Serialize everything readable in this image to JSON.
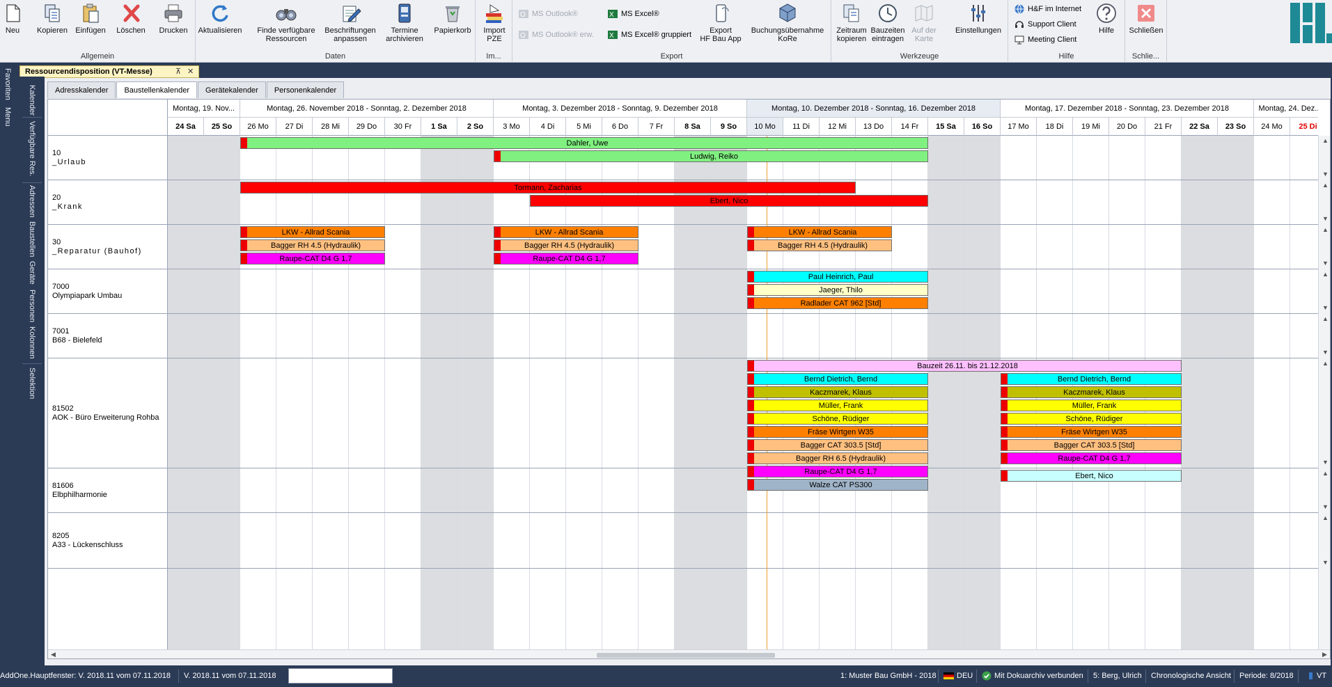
{
  "ribbon": {
    "groups": {
      "allgemein": "Allgemein",
      "daten": "Daten",
      "import": "Im...",
      "export": "Export",
      "werkzeuge": "Werkzeuge",
      "hilfe": "Hilfe",
      "schliessen": "Schlie..."
    },
    "buttons": {
      "neu": "Neu",
      "kopieren": "Kopieren",
      "einfuegen": "Einfügen",
      "loeschen": "Löschen",
      "drucken": "Drucken",
      "aktualisieren": "Aktualisieren",
      "finde_l1": "Finde verfügbare",
      "finde_l2": "Ressourcen",
      "beschr_l1": "Beschriftungen",
      "beschr_l2": "anpassen",
      "termine_l1": "Termine",
      "termine_l2": "archivieren",
      "papierkorb": "Papierkorb",
      "import_l1": "Import",
      "import_l2": "PZE",
      "ms_outlook": "MS Outlook®",
      "ms_outlook_erw": "MS Outlook® erw.",
      "ms_excel": "MS Excel®",
      "ms_excel_grp": "MS Excel® gruppiert",
      "export_l1": "Export",
      "export_l2": "HF Bau App",
      "buchung_l1": "Buchungsübernahme",
      "buchung_l2": "KoRe",
      "zeitraum_l1": "Zeitraum",
      "zeitraum_l2": "kopieren",
      "bauzeiten_l1": "Bauzeiten",
      "bauzeiten_l2": "eintragen",
      "karte_l1": "Auf der",
      "karte_l2": "Karte",
      "einstellungen": "Einstellungen",
      "hf_internet": "H&F im Internet",
      "support": "Support Client",
      "meeting": "Meeting Client",
      "hilfe": "Hilfe",
      "schliessen": "Schließen"
    }
  },
  "left_outer_tabs": [
    "Favoriten",
    "Menu"
  ],
  "left_inner_tabs": [
    "Kalender",
    "Verfügbare Res.",
    "Adressen",
    "Baustellen",
    "Geräte",
    "Personen",
    "Kolonnen",
    "Selektion"
  ],
  "doc_tab": {
    "title": "Ressourcendisposition (VT-Messe)",
    "pin": "⊼",
    "close": "✕"
  },
  "subtabs": [
    "Adresskalender",
    "Baustellenkalender",
    "Gerätekalender",
    "Personenkalender"
  ],
  "calendar": {
    "weeks": [
      "Montag, 19. Nov...",
      "Montag, 26. November 2018 - Sonntag, 2. Dezember 2018",
      "Montag, 3. Dezember 2018 - Sonntag, 9. Dezember 2018",
      "Montag, 10. Dezember 2018 - Sonntag, 16. Dezember 2018",
      "Montag, 17. Dezember 2018 - Sonntag, 23. Dezember 2018",
      "Montag, 24. Dez..."
    ],
    "days": [
      "24 Sa",
      "25 So",
      "26 Mo",
      "27 Di",
      "28 Mi",
      "29 Do",
      "30 Fr",
      "1 Sa",
      "2 So",
      "3 Mo",
      "4 Di",
      "5 Mi",
      "6 Do",
      "7 Fr",
      "8 Sa",
      "9 So",
      "10 Mo",
      "11 Di",
      "12 Mi",
      "13 Do",
      "14 Fr",
      "15 Sa",
      "16 So",
      "17 Mo",
      "18 Di",
      "19 Mi",
      "20 Do",
      "21 Fr",
      "22 Sa",
      "23 So",
      "24 Mo",
      "25 Di"
    ],
    "rows": [
      {
        "code": "10",
        "name": "_Urlaub"
      },
      {
        "code": "20",
        "name": "_Krank"
      },
      {
        "code": "30",
        "name": "_Reparatur (Bauhof)"
      },
      {
        "code": "7000",
        "name": "Olympiapark Umbau"
      },
      {
        "code": "7001",
        "name": "B68 - Bielefeld"
      },
      {
        "code": "81502",
        "name": "AOK - Büro Erweiterung Rohba"
      },
      {
        "code": "81606",
        "name": "Elbphilharmonie"
      },
      {
        "code": "8205",
        "name": "A33 - Lückenschluss"
      }
    ],
    "bars": [
      {
        "row": 0,
        "lane": 0,
        "start": 2,
        "end": 21,
        "label": "Dahler, Uwe",
        "color": "#80f080",
        "marker": true
      },
      {
        "row": 0,
        "lane": 1,
        "start": 9,
        "end": 21,
        "label": "Ludwig, Reiko",
        "color": "#80f080",
        "marker": true
      },
      {
        "row": 1,
        "lane": 0,
        "start": 2,
        "end": 19,
        "label": "Tormann, Zacharias",
        "color": "#ff0000",
        "marker": false
      },
      {
        "row": 1,
        "lane": 1,
        "start": 10,
        "end": 21,
        "label": "Ebert, Nico",
        "color": "#ff0000",
        "marker": false
      },
      {
        "row": 2,
        "lane": 0,
        "start": 2,
        "end": 6,
        "label": "LKW - Allrad Scania",
        "color": "#ff8000",
        "marker": true
      },
      {
        "row": 2,
        "lane": 1,
        "start": 2,
        "end": 6,
        "label": "Bagger RH 4.5 (Hydraulik)",
        "color": "#ffc080",
        "marker": true
      },
      {
        "row": 2,
        "lane": 2,
        "start": 2,
        "end": 6,
        "label": "Raupe-CAT D4 G 1,7",
        "color": "#ff00ff",
        "marker": true
      },
      {
        "row": 2,
        "lane": 0,
        "start": 9,
        "end": 13,
        "label": "LKW - Allrad Scania",
        "color": "#ff8000",
        "marker": true
      },
      {
        "row": 2,
        "lane": 1,
        "start": 9,
        "end": 13,
        "label": "Bagger RH 4.5 (Hydraulik)",
        "color": "#ffc080",
        "marker": true
      },
      {
        "row": 2,
        "lane": 2,
        "start": 9,
        "end": 13,
        "label": "Raupe-CAT D4 G 1,7",
        "color": "#ff00ff",
        "marker": true
      },
      {
        "row": 2,
        "lane": 0,
        "start": 16,
        "end": 20,
        "label": "LKW - Allrad Scania",
        "color": "#ff8000",
        "marker": true
      },
      {
        "row": 2,
        "lane": 1,
        "start": 16,
        "end": 20,
        "label": "Bagger RH 4.5 (Hydraulik)",
        "color": "#ffc080",
        "marker": true
      },
      {
        "row": 3,
        "lane": 0,
        "start": 16,
        "end": 21,
        "label": "Paul Heinrich, Paul",
        "color": "#00ffff",
        "marker": true
      },
      {
        "row": 3,
        "lane": 1,
        "start": 16,
        "end": 21,
        "label": "Jaeger, Thilo",
        "color": "#ffffc8",
        "marker": true
      },
      {
        "row": 3,
        "lane": 2,
        "start": 16,
        "end": 21,
        "label": "Radlader CAT 962 [Std]",
        "color": "#ff8000",
        "marker": true
      },
      {
        "row": 5,
        "lane": 0,
        "start": 16,
        "end": 28,
        "label": "Bauzeit 26.11. bis 21.12.2018",
        "color": "#ffc0ff",
        "marker": true
      },
      {
        "row": 5,
        "lane": 1,
        "start": 16,
        "end": 21,
        "label": "Bernd Dietrich, Bernd",
        "color": "#00ffff",
        "marker": true
      },
      {
        "row": 5,
        "lane": 2,
        "start": 16,
        "end": 21,
        "label": "Kaczmarek, Klaus",
        "color": "#c0c000",
        "marker": true
      },
      {
        "row": 5,
        "lane": 3,
        "start": 16,
        "end": 21,
        "label": "Müller, Frank",
        "color": "#ffff00",
        "marker": true
      },
      {
        "row": 5,
        "lane": 4,
        "start": 16,
        "end": 21,
        "label": "Schöne, Rüdiger",
        "color": "#ffff00",
        "marker": true
      },
      {
        "row": 5,
        "lane": 5,
        "start": 16,
        "end": 21,
        "label": "Fräse Wirtgen W35",
        "color": "#ff8000",
        "marker": true
      },
      {
        "row": 5,
        "lane": 6,
        "start": 16,
        "end": 21,
        "label": "Bagger CAT 303.5 [Std]",
        "color": "#ffc080",
        "marker": true
      },
      {
        "row": 5,
        "lane": 7,
        "start": 16,
        "end": 21,
        "label": "Bagger RH 6.5 (Hydraulik)",
        "color": "#ffc080",
        "marker": true
      },
      {
        "row": 5,
        "lane": 8,
        "start": 16,
        "end": 21,
        "label": "Raupe-CAT D4 G 1,7",
        "color": "#ff00ff",
        "marker": true
      },
      {
        "row": 5,
        "lane": 9,
        "start": 16,
        "end": 21,
        "label": "Walze CAT PS300",
        "color": "#a0b4c8",
        "marker": true
      },
      {
        "row": 5,
        "lane": 1,
        "start": 23,
        "end": 28,
        "label": "Bernd Dietrich, Bernd",
        "color": "#00ffff",
        "marker": true
      },
      {
        "row": 5,
        "lane": 2,
        "start": 23,
        "end": 28,
        "label": "Kaczmarek, Klaus",
        "color": "#c0c000",
        "marker": true
      },
      {
        "row": 5,
        "lane": 3,
        "start": 23,
        "end": 28,
        "label": "Müller, Frank",
        "color": "#ffff00",
        "marker": true
      },
      {
        "row": 5,
        "lane": 4,
        "start": 23,
        "end": 28,
        "label": "Schöne, Rüdiger",
        "color": "#ffff00",
        "marker": true
      },
      {
        "row": 5,
        "lane": 5,
        "start": 23,
        "end": 28,
        "label": "Fräse Wirtgen W35",
        "color": "#ff8000",
        "marker": true
      },
      {
        "row": 5,
        "lane": 6,
        "start": 23,
        "end": 28,
        "label": "Bagger CAT 303.5 [Std]",
        "color": "#ffc080",
        "marker": true
      },
      {
        "row": 5,
        "lane": 7,
        "start": 23,
        "end": 28,
        "label": "Raupe-CAT D4 G 1,7",
        "color": "#ff00ff",
        "marker": true
      },
      {
        "row": 6,
        "lane": 0,
        "start": 23,
        "end": 28,
        "label": "Ebert, Nico",
        "color": "#c8ffff",
        "marker": true
      }
    ]
  },
  "status": {
    "main_window": "AddOne.Hauptfenster: V. 2018.11 vom 07.11.2018",
    "version": "V. 2018.11 vom 07.11.2018",
    "company": "1: Muster Bau GmbH - 2018",
    "lang": "DEU",
    "archive": "Mit Dokuarchiv verbunden",
    "user": "5: Berg, Ulrich",
    "view": "Chronologische Ansicht",
    "period": "Periode: 8/2018",
    "vt": "VT"
  },
  "colors": {
    "frame": "#2b3a55",
    "weekend": "#dcdde0",
    "today_line": "#f0a030",
    "marker": "#ee0000"
  }
}
